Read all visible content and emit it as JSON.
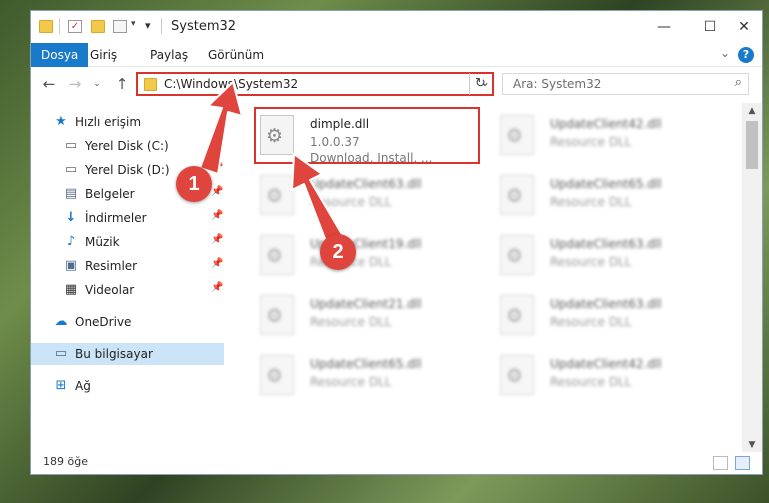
{
  "window": {
    "title": "System32",
    "controls": {
      "minimize": "—",
      "maximize": "☐",
      "close": "✕"
    }
  },
  "ribbon": {
    "tabs": [
      "Dosya",
      "Giriş",
      "Paylaş",
      "Görünüm"
    ],
    "help": "?"
  },
  "nav": {
    "address": "C:\\Windows\\System32",
    "search_placeholder": "Ara: System32"
  },
  "sidebar": {
    "items": [
      {
        "label": "Hızlı erişim",
        "icon": "star-icon"
      },
      {
        "label": "Yerel Disk (C:)",
        "icon": "drive-icon",
        "pinned": true
      },
      {
        "label": "Yerel Disk (D:)",
        "icon": "drive-icon",
        "pinned": true
      },
      {
        "label": "Belgeler",
        "icon": "documents-icon",
        "pinned": true
      },
      {
        "label": "İndirmeler",
        "icon": "download-icon",
        "pinned": true
      },
      {
        "label": "Müzik",
        "icon": "music-icon",
        "pinned": true
      },
      {
        "label": "Resimler",
        "icon": "pictures-icon",
        "pinned": true
      },
      {
        "label": "Videolar",
        "icon": "videos-icon",
        "pinned": true
      },
      {
        "label": "OneDrive",
        "icon": "cloud-icon"
      },
      {
        "label": "Bu bilgisayar",
        "icon": "computer-icon",
        "selected": true
      },
      {
        "label": "Ağ",
        "icon": "network-icon"
      }
    ]
  },
  "files": [
    {
      "name": "dimple.dll",
      "line1": "1.0.0.37",
      "line2": "Download, Install, ...",
      "highlighted": true
    },
    {
      "name": "UpdateClient42.dll",
      "line1": "Resource DLL"
    },
    {
      "name": "UpdateClient63.dll",
      "line1": "Resource DLL"
    },
    {
      "name": "UpdateClient65.dll",
      "line1": "Resource DLL"
    },
    {
      "name": "UpdateClient19.dll",
      "line1": "Resource DLL"
    },
    {
      "name": "UpdateClient63.dll",
      "line1": "Resource DLL"
    },
    {
      "name": "UpdateClient21.dll",
      "line1": "Resource DLL"
    },
    {
      "name": "UpdateClient63.dll",
      "line1": "Resource DLL"
    },
    {
      "name": "UpdateClient65.dll",
      "line1": "Resource DLL"
    },
    {
      "name": "UpdateClient42.dll",
      "line1": "Resource DLL"
    }
  ],
  "status": {
    "count": "189 öğe"
  },
  "markers": [
    "1",
    "2"
  ],
  "colors": {
    "accent": "#1979ca",
    "highlight": "#d9332b",
    "marker": "#e0453d",
    "selected": "#cce4f7"
  }
}
